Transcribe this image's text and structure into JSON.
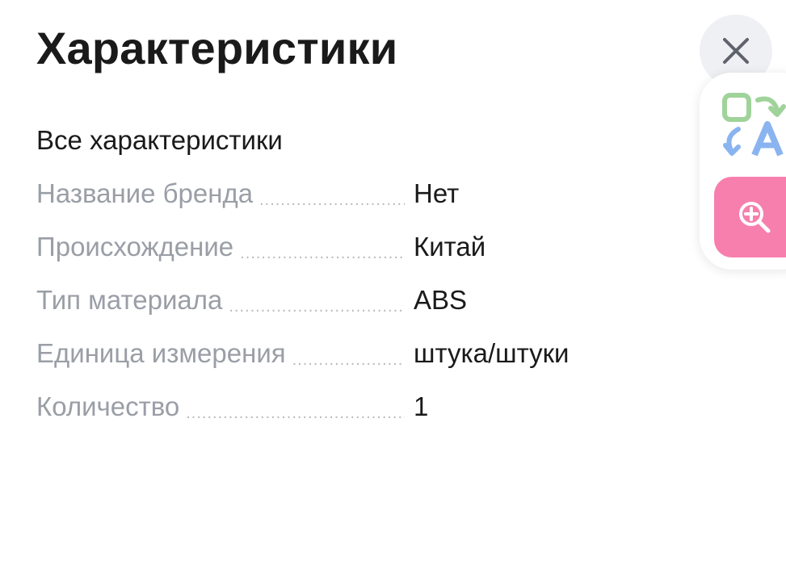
{
  "header": {
    "title": "Характеристики"
  },
  "section": {
    "title": "Все характеристики"
  },
  "specs": [
    {
      "name": "Название бренда",
      "value": "Нет"
    },
    {
      "name": "Происхождение",
      "value": "Китай"
    },
    {
      "name": "Тип материала",
      "value": "ABS"
    },
    {
      "name": "Единица измерения",
      "value": "штука/штуки"
    },
    {
      "name": "Количество",
      "value": "1"
    }
  ],
  "icons": {
    "close": "close-icon",
    "translate": "translate-icon",
    "zoom": "zoom-in-icon"
  },
  "colors": {
    "title_text": "#1a1a1a",
    "label_text": "#9a9ea6",
    "close_bg": "#eef0f3",
    "zoom_bg": "#f77fae",
    "translate_green": "#9fd39a",
    "translate_blue": "#8ab4f0"
  }
}
